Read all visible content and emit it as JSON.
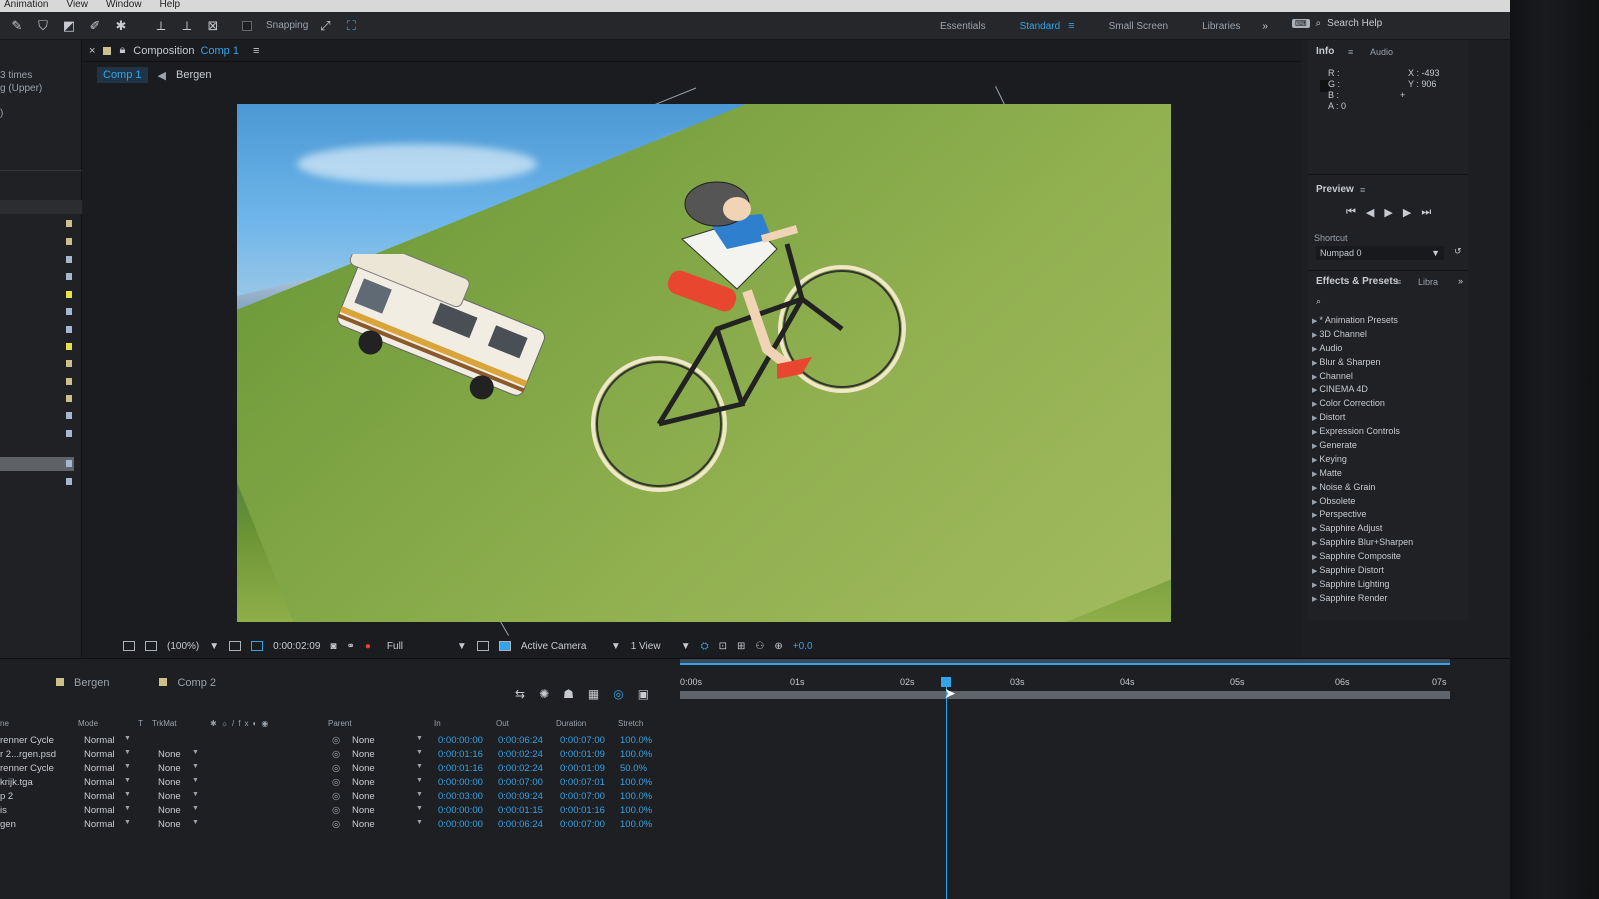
{
  "menubar": {
    "items": [
      "Animation",
      "View",
      "Window",
      "Help"
    ]
  },
  "toolbar": {
    "snapping_label": "Snapping"
  },
  "workspaces": {
    "items": [
      "Essentials",
      "Standard",
      "Small Screen",
      "Libraries"
    ],
    "active": "Standard"
  },
  "search_help": {
    "label": "Search Help"
  },
  "left_panel": {
    "line1": "3 times",
    "line2": "g (Upper)",
    "line3": ")"
  },
  "composition": {
    "label": "Composition",
    "name": "Comp 1",
    "tabs": [
      "Comp 1",
      "Bergen"
    ],
    "zoom": "(100%)",
    "timecode": "0:00:02:09",
    "resolution": "Full",
    "camera": "Active Camera",
    "views": "1 View",
    "exposure": "+0.0"
  },
  "info_panel": {
    "title": "Info",
    "tab_audio": "Audio",
    "r": "R :",
    "g": "G :",
    "b": "B :",
    "a": "A : 0",
    "x": "X : -493",
    "y": "Y : 906"
  },
  "preview_panel": {
    "title": "Preview",
    "shortcut_label": "Shortcut",
    "shortcut_value": "Numpad 0"
  },
  "effects_panel": {
    "title": "Effects & Presets",
    "tab_libraries": "Libra",
    "items": [
      "* Animation Presets",
      "3D Channel",
      "Audio",
      "Blur & Sharpen",
      "Channel",
      "CINEMA 4D",
      "Color Correction",
      "Distort",
      "Expression Controls",
      "Generate",
      "Keying",
      "Matte",
      "Noise & Grain",
      "Obsolete",
      "Perspective",
      "Sapphire Adjust",
      "Sapphire Blur+Sharpen",
      "Sapphire Composite",
      "Sapphire Distort",
      "Sapphire Lighting",
      "Sapphire Render"
    ]
  },
  "timeline": {
    "tabs": [
      "Bergen",
      "Comp 2"
    ],
    "columns": {
      "mode": "Mode",
      "t": "T",
      "trkmat": "TrkMat",
      "parent": "Parent",
      "in": "In",
      "out": "Out",
      "duration": "Duration",
      "stretch": "Stretch",
      "name": "ne"
    },
    "ruler_labels": [
      "0:00s",
      "01s",
      "02s",
      "03s",
      "04s",
      "05s",
      "06s",
      "07s"
    ],
    "layers": [
      {
        "name": "renner Cycle",
        "mode": "Normal",
        "trkmat": "",
        "parent": "None",
        "in": "0:00:00:00",
        "out": "0:00:06:24",
        "duration": "0:00:07:00",
        "stretch": "100.0%"
      },
      {
        "name": "r 2...rgen.psd",
        "mode": "Normal",
        "trkmat": "None",
        "parent": "None",
        "in": "0:00:01:16",
        "out": "0:00:02:24",
        "duration": "0:00:01:09",
        "stretch": "100.0%"
      },
      {
        "name": "renner Cycle",
        "mode": "Normal",
        "trkmat": "None",
        "parent": "None",
        "in": "0:00:01:16",
        "out": "0:00:02:24",
        "duration": "0:00:01:09",
        "stretch": "50.0%"
      },
      {
        "name": "krijk.tga",
        "mode": "Normal",
        "trkmat": "None",
        "parent": "None",
        "in": "0:00:00:00",
        "out": "0:00:07:00",
        "duration": "0:00:07:01",
        "stretch": "100.0%"
      },
      {
        "name": "p 2",
        "mode": "Normal",
        "trkmat": "None",
        "parent": "None",
        "in": "0:00:03:00",
        "out": "0:00:09:24",
        "duration": "0:00:07:00",
        "stretch": "100.0%"
      },
      {
        "name": "is",
        "mode": "Normal",
        "trkmat": "None",
        "parent": "None",
        "in": "0:00:00:00",
        "out": "0:00:01:15",
        "duration": "0:00:01:16",
        "stretch": "100.0%"
      },
      {
        "name": "gen",
        "mode": "Normal",
        "trkmat": "None",
        "parent": "None",
        "in": "0:00:00:00",
        "out": "0:00:06:24",
        "duration": "0:00:07:00",
        "stretch": "100.0%"
      }
    ]
  },
  "colors": {
    "accent": "#34a3e8",
    "panel": "#1f2124",
    "label_sand": "#cdbf8a"
  }
}
